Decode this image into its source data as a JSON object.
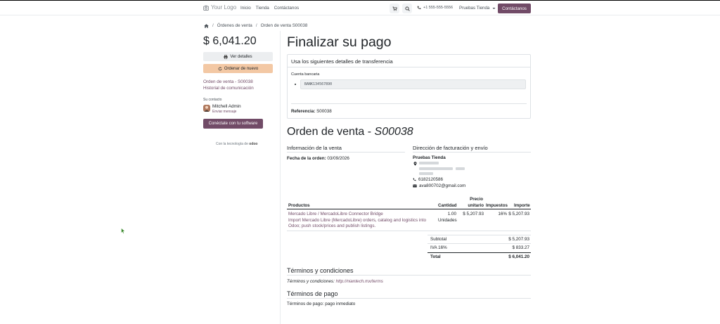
{
  "header": {
    "logo_text": "Your Logo",
    "nav": [
      "Inicio",
      "Tienda",
      "Contáctanos"
    ],
    "phone": "+1 555-555-5556",
    "shop_dropdown": "Pruebas Tienda",
    "contact_button": "Contáctanos"
  },
  "breadcrumb": {
    "items": [
      "Órdenes de venta",
      "Orden de venta S00038"
    ]
  },
  "sidebar": {
    "amount": "$ 6,041.20",
    "view_details": "Ver detalles",
    "reorder": "Ordenar de nuevo",
    "order_link": "Orden de venta - S00038",
    "history_link": "Historial de comunicación",
    "contact_label": "Su contacto",
    "contact_name": "Mitchell Admin",
    "send_message": "Enviar mensaje",
    "connect_button": "Conéctate con tu software",
    "powered_by": "Con la tecnología de",
    "powered_brand": "odoo"
  },
  "payment": {
    "title": "Finalizar su pago",
    "panel_title": "Usa los siguientes detalles de transferencia",
    "bank_account_label": "Cuenta bancaria",
    "bank_account": "BANK134567890",
    "reference_label": "Referencia:",
    "reference_value": "S00038"
  },
  "order": {
    "title_prefix": "Orden de venta - ",
    "title_number": "S00038",
    "info_title": "Información de la venta",
    "date_label": "Fecha de la orden:",
    "date_value": "03/09/2026",
    "address_title": "Dirección de facturación y envío",
    "customer_name": "Pruebas Tienda",
    "phone": "6182120586",
    "email": "ava800702@gmail.com"
  },
  "table": {
    "headers": {
      "product": "Productos",
      "quantity": "Cantidad",
      "unit_price_1": "Precio",
      "unit_price_2": "unitario",
      "taxes": "Impuestos",
      "amount": "Importe"
    },
    "rows": [
      {
        "product_line1": "Mercado Libre / MercadoLibre Connector Bridge",
        "product_line2": "Import Mercado Libre (MercadoLibre) orders, catalog and logistics into",
        "product_line3": "Odoo; push stock/prices and publish listings.",
        "quantity": "1.00",
        "unit": "Unidades",
        "unit_price": "$ 5,207.93",
        "tax": "16%",
        "amount": "$ 5,207.93"
      }
    ]
  },
  "totals": {
    "subtotal_label": "Subtotal",
    "subtotal_value": "$ 5,207.93",
    "tax_label": "IVA 16%",
    "tax_value": "$ 833.27",
    "total_label": "Total",
    "total_value": "$ 6,041.20"
  },
  "terms": {
    "title": "Términos y condiciones",
    "label": "Términos y condiciones:",
    "url": "http://niantech.mx/terms",
    "payment_title": "Términos de pago",
    "payment_text": "Términos de pago: pago inmediato"
  },
  "colors": {
    "brand": "#714B67",
    "reorder_button": "#F3C8A4",
    "light_button": "#ECEEF0"
  },
  "icons": [
    "home-icon",
    "cart-icon",
    "search-icon",
    "phone-icon",
    "printer-icon",
    "refresh-icon",
    "map-marker-icon",
    "envelope-icon",
    "caret-down-icon",
    "mouse-cursor-icon"
  ]
}
